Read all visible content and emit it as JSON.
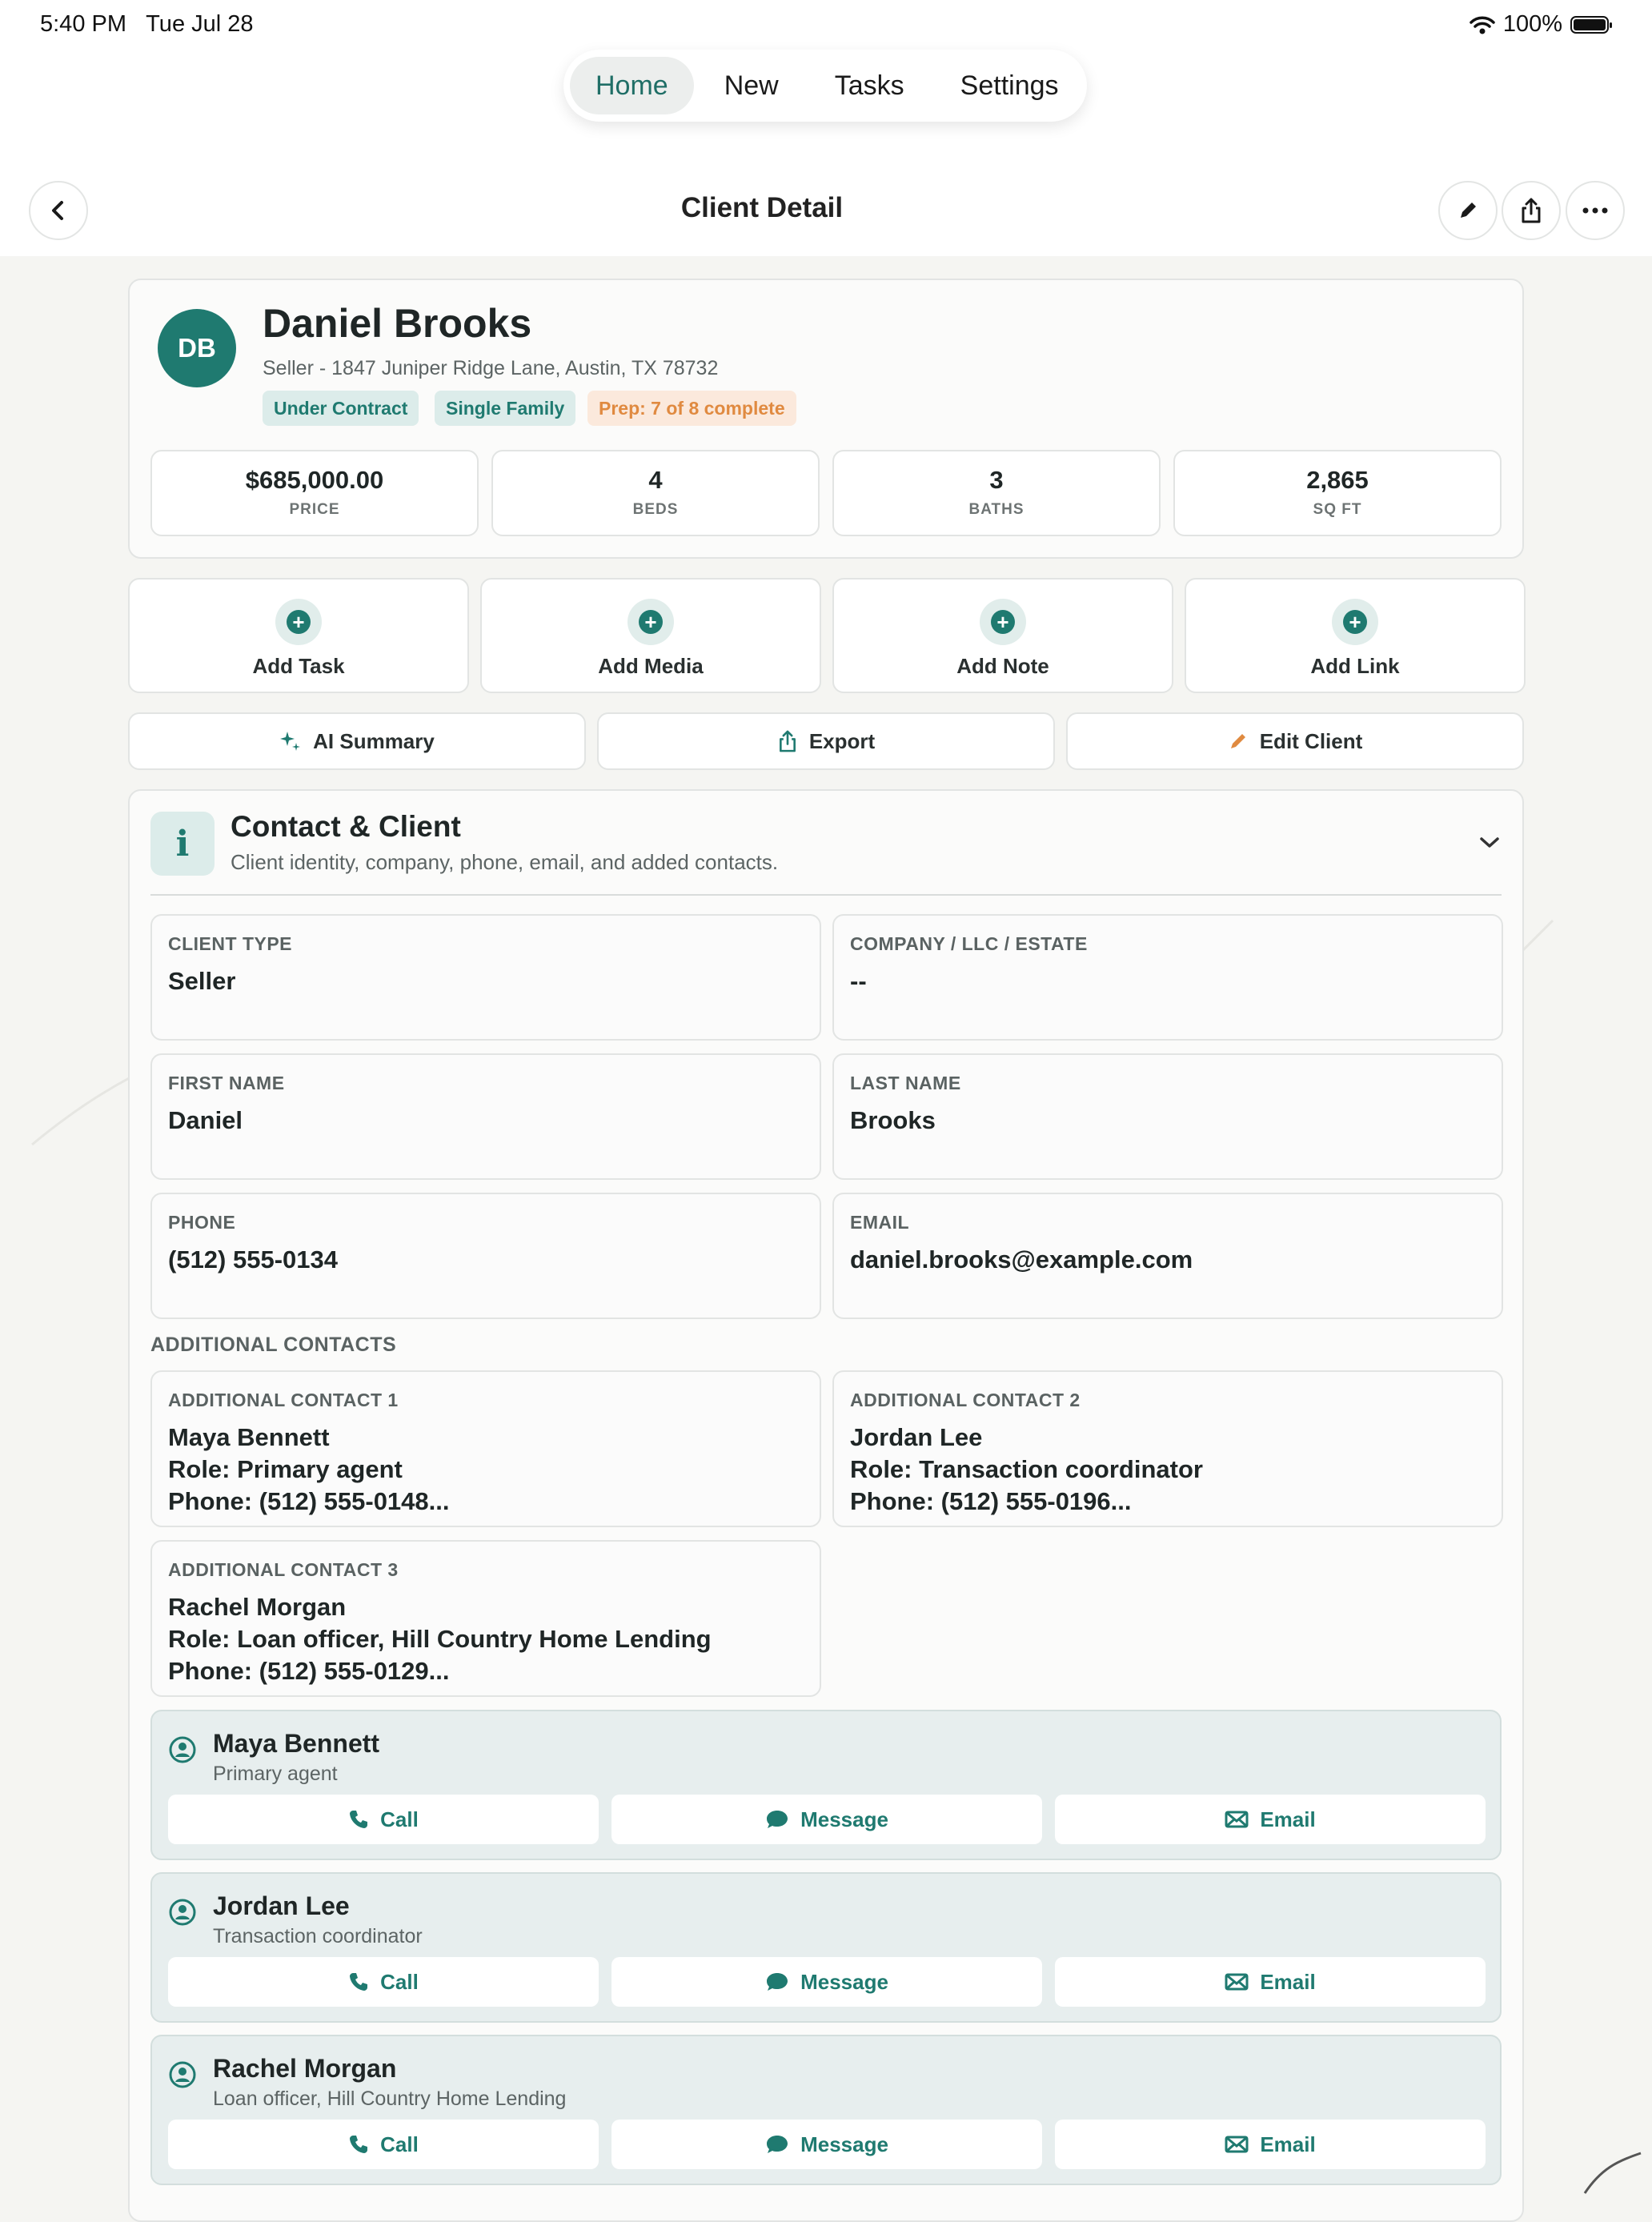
{
  "status": {
    "time": "5:40 PM",
    "date": "Tue Jul 28",
    "battery": "100%"
  },
  "tabs": [
    {
      "label": "Home",
      "active": true
    },
    {
      "label": "New",
      "active": false
    },
    {
      "label": "Tasks",
      "active": false
    },
    {
      "label": "Settings",
      "active": false
    }
  ],
  "nav": {
    "title": "Client Detail",
    "icons": [
      "back-icon",
      "edit-icon",
      "share-icon",
      "more-icon"
    ]
  },
  "client": {
    "initials": "DB",
    "name": "Daniel Brooks",
    "subtitle": "Seller - 1847 Juniper Ridge Lane, Austin, TX 78732",
    "tags": [
      "Under Contract",
      "Single Family",
      "Prep: 7 of 8 complete"
    ],
    "stats": [
      {
        "value": "$685,000.00",
        "label": "PRICE"
      },
      {
        "value": "4",
        "label": "BEDS"
      },
      {
        "value": "3",
        "label": "BATHS"
      },
      {
        "value": "2,865",
        "label": "SQ FT"
      }
    ]
  },
  "actions": [
    "Add Task",
    "Add Media",
    "Add Note",
    "Add Link"
  ],
  "tools": [
    {
      "label": "AI Summary",
      "icon": "sparkle-icon"
    },
    {
      "label": "Export",
      "icon": "share-icon"
    },
    {
      "label": "Edit Client",
      "icon": "pencil-icon"
    }
  ],
  "section": {
    "icon": "i",
    "title": "Contact & Client",
    "subtitle": "Client identity, company, phone, email, and added contacts."
  },
  "fields": [
    {
      "label": "CLIENT TYPE",
      "value": "Seller"
    },
    {
      "label": "COMPANY / LLC / ESTATE",
      "value": "--"
    },
    {
      "label": "FIRST NAME",
      "value": "Daniel"
    },
    {
      "label": "LAST NAME",
      "value": "Brooks"
    },
    {
      "label": "PHONE",
      "value": "(512) 555-0134"
    },
    {
      "label": "EMAIL",
      "value": "daniel.brooks@example.com"
    }
  ],
  "additional_heading": "ADDITIONAL CONTACTS",
  "additional": [
    {
      "label": "ADDITIONAL CONTACT 1",
      "line1": "Maya Bennett",
      "line2": "Role: Primary agent",
      "line3": "Phone: (512) 555-0148..."
    },
    {
      "label": "ADDITIONAL CONTACT 2",
      "line1": "Jordan Lee",
      "line2": "Role: Transaction coordinator",
      "line3": "Phone: (512) 555-0196..."
    },
    {
      "label": "ADDITIONAL CONTACT 3",
      "line1": "Rachel Morgan",
      "line2": "Role: Loan officer, Hill Country Home Lending",
      "line3": "Phone: (512) 555-0129..."
    }
  ],
  "contacts": [
    {
      "name": "Maya Bennett",
      "role": "Primary agent"
    },
    {
      "name": "Jordan Lee",
      "role": "Transaction coordinator"
    },
    {
      "name": "Rachel Morgan",
      "role": "Loan officer, Hill Country Home Lending"
    }
  ],
  "contact_buttons": {
    "call": "Call",
    "message": "Message",
    "email": "Email"
  },
  "colors": {
    "accent": "#1f7a70",
    "orange": "#e08a40",
    "background": "#f5f5f2"
  }
}
